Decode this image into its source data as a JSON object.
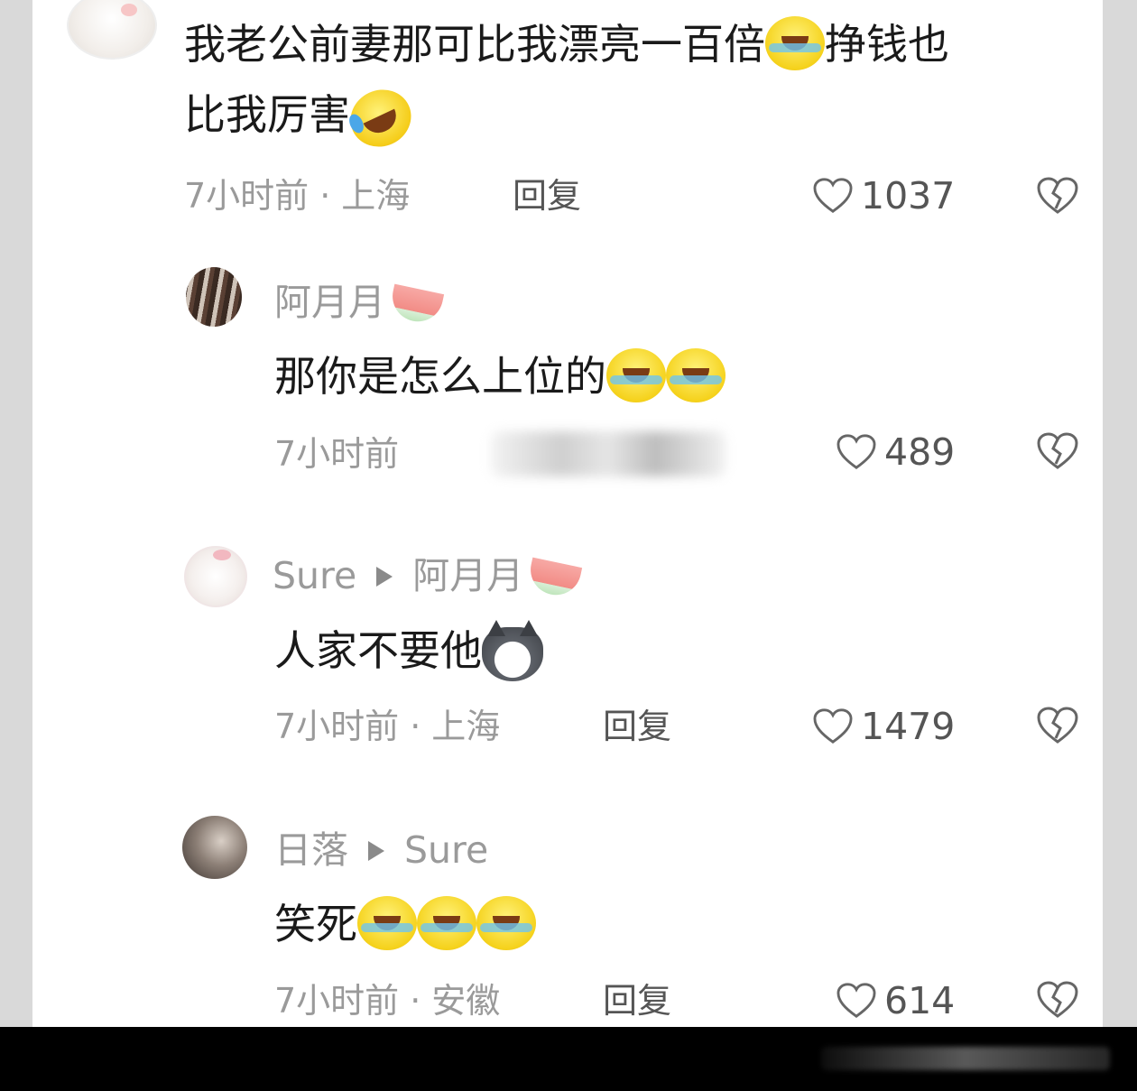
{
  "comments": [
    {
      "text_part1": "我老公前妻那可比我漂亮一百倍",
      "text_part2": "挣钱也",
      "text_line2": "比我厉害",
      "time": "7小时前",
      "location": "上海",
      "reply": "回复",
      "likes": "1037"
    },
    {
      "author": "阿月月",
      "text": "那你是怎么上位的",
      "time": "7小时前",
      "likes": "489"
    },
    {
      "author": "Sure",
      "reply_to": "阿月月",
      "text": "人家不要他",
      "time": "7小时前",
      "location": "上海",
      "reply": "回复",
      "likes": "1479"
    },
    {
      "author": "日落",
      "reply_to": "Sure",
      "text": "笑死",
      "time": "7小时前",
      "location": "安徽",
      "reply": "回复",
      "likes": "614"
    }
  ],
  "separator": "·",
  "icons": {
    "like": "heart-outline-icon",
    "dislike": "broken-heart-icon",
    "reply_arrow": "play-triangle-icon",
    "emoji_laugh": "tears-of-joy-emoji",
    "emoji_rofl": "rolling-on-floor-laughing-emoji",
    "emoji_wolf": "husky-dog-emoji",
    "emoji_melon": "watermelon-emoji"
  }
}
